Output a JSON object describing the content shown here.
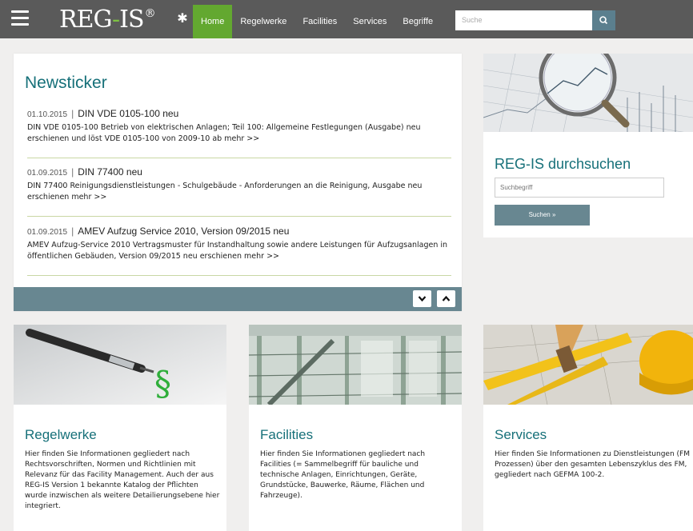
{
  "brand": {
    "name_left": "REG",
    "name_dash": "-",
    "name_right": "IS",
    "mark": "®"
  },
  "nav": {
    "items": [
      {
        "label": "Home",
        "active": true
      },
      {
        "label": "Regelwerke"
      },
      {
        "label": "Facilities"
      },
      {
        "label": "Services"
      },
      {
        "label": "Begriffe"
      }
    ],
    "search_placeholder": "Suche"
  },
  "news": {
    "title": "Newsticker",
    "items": [
      {
        "date": "01.10.2015",
        "separator": "|",
        "title": "DIN VDE 0105-100 neu",
        "text": "DIN VDE 0105-100 Betrieb von elektrischen Anlagen; Teil 100: Allgemeine Festlegungen (Ausgabe) neu erschienen und löst VDE 0105-100 von 2009-10 ab  mehr >>"
      },
      {
        "date": "01.09.2015",
        "separator": "|",
        "title": "DIN 77400 neu",
        "text": "DIN 77400 Reinigungsdienstleistungen - Schulgebäude - Anforderungen an die Reinigung, Ausgabe neu erschienen  mehr >>"
      },
      {
        "date": "01.09.2015",
        "separator": "|",
        "title": "AMEV Aufzug Service 2010, Version 09/2015 neu",
        "text": "AMEV Aufzug-Service 2010 Vertragsmuster für Instandhaltung sowie andere Leistungen für Aufzugsanlagen in öffentlichen Gebäuden, Version 09/2015 neu erschienen  mehr >>"
      }
    ]
  },
  "search_panel": {
    "title": "REG-IS durchsuchen",
    "placeholder": "Suchbegriff",
    "button": "Suchen »"
  },
  "cards": [
    {
      "title": "Regelwerke",
      "text": "Hier finden Sie Informationen gegliedert nach Rechtsvorschriften, Normen und Richtlinien mit Relevanz für das Facility Management. Auch der aus REG-IS Version 1 bekannte Katalog der Pflichten wurde inzwischen als weitere Detailierungsebene hier integriert.",
      "image_glyph": "§"
    },
    {
      "title": "Facilities",
      "text": "Hier finden Sie Informationen gegliedert nach Facilities (= Sammelbegriff für bauliche und technische Anlagen, Einrichtungen, Geräte, Grundstücke, Bauwerke, Räume, Flächen und Fahrzeuge)."
    },
    {
      "title": "Services",
      "text": "Hier finden Sie Informationen zu Dienstleistungen (FM Prozessen) über den gesamten Lebenszyklus des FM, gegliedert nach GEFMA 100-2."
    }
  ],
  "icons": {
    "menu": "hamburger-icon",
    "settings": "gear-icon",
    "search": "search-icon",
    "down": "chevron-down-icon",
    "up": "chevron-up-icon"
  },
  "colors": {
    "nav_bg": "#5a5a5a",
    "nav_active": "#63a830",
    "accent_teal": "#167079",
    "panel_bar": "#688791"
  }
}
